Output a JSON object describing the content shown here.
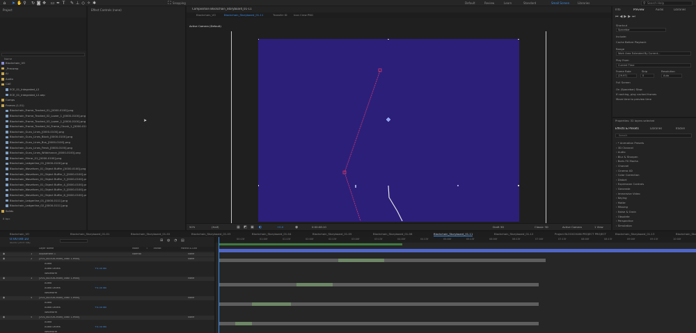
{
  "toolbar": {
    "workspaces": [
      "Default",
      "Review",
      "Learn",
      "Standard",
      "Small Screen",
      "Libraries"
    ],
    "active_workspace": "Default",
    "search_placeholder": "Search Help",
    "tool_icons": [
      "home-icon",
      "selection-tool-icon",
      "hand-tool-icon",
      "zoom-tool-icon",
      "rotate-tool-icon",
      "camera-tool-icon",
      "pan-behind-tool-icon",
      "rectangle-tool-icon",
      "pen-tool-icon",
      "type-tool-icon",
      "brush-tool-icon",
      "clone-stamp-icon",
      "eraser-icon",
      "roto-brush-icon",
      "puppet-pin-icon"
    ],
    "snapping_label": "Snapping"
  },
  "project": {
    "tab_label": "Project",
    "name_header": "Name",
    "items": [
      {
        "label": "Blockchain_VO",
        "kind": "comp"
      },
      {
        "label": "_Precomp",
        "kind": "folder"
      },
      {
        "label": "AI",
        "kind": "folder"
      },
      {
        "label": "Audio",
        "kind": "folder"
      },
      {
        "label": "CAE",
        "kind": "folder"
      },
      {
        "label": "ECE_01_Integrated_L2",
        "kind": "footage"
      },
      {
        "label": "ECE_01_Integrated_L2.aep",
        "kind": "footage"
      },
      {
        "label": "Comps",
        "kind": "folder"
      },
      {
        "label": "Frames (1-51)",
        "kind": "folder"
      },
      {
        "label": "Blockchain_Frame_Tracked_01_[0000-0100].png",
        "kind": "footage"
      },
      {
        "label": "Blockchain_Frame_Tracked_02_Lower_1_[0000-0100].png",
        "kind": "footage"
      },
      {
        "label": "Blockchain_Frame_Tracked_03_Lower_1_[0000-0100].png",
        "kind": "footage"
      },
      {
        "label": "Blockchain_Frame_Tracked_04_Frame_Chunk_1_[0000-0100].png",
        "kind": "footage"
      },
      {
        "label": "Blockchain_Guns_Lines_[0000-0100].png",
        "kind": "footage"
      },
      {
        "label": "Blockchain_Guns_Lines_Block_[0000-0100].png",
        "kind": "footage"
      },
      {
        "label": "Blockchain_Guns_Lines_Bus_[0000-0100].png",
        "kind": "footage"
      },
      {
        "label": "Blockchain_Guns_Lines_Fresh_[0000-0100].png",
        "kind": "footage"
      },
      {
        "label": "Blockchain_Guns_Lines_Wildchance_[0000-0100].png",
        "kind": "footage"
      },
      {
        "label": "Blockchain_Mirror_01_[0000-0100].png",
        "kind": "footage"
      },
      {
        "label": "Blockchain_Ledgerline_01_[0000-0100].png",
        "kind": "footage"
      },
      {
        "label": "Blockchain_Waveform_01_Object Buffer_[0000-0100].png",
        "kind": "footage"
      },
      {
        "label": "Blockchain_Waveform_01_Object Buffer_2_[0000-0100].png",
        "kind": "footage"
      },
      {
        "label": "Blockchain_Waveform_01_Object Buffer_3_[0000-0100].png",
        "kind": "footage"
      },
      {
        "label": "Blockchain_Waveform_01_Object Buffer_4_[0000-0100].png",
        "kind": "footage"
      },
      {
        "label": "Blockchain_Waveform_01_Object Buffer_5_[0000-0100].png",
        "kind": "footage"
      },
      {
        "label": "Blockchain_Waveform_01_Object Buffer_6_[0000-0100].png",
        "kind": "footage"
      },
      {
        "label": "Blockchain_Ledgerline_01_[0000-0111].png",
        "kind": "footage"
      },
      {
        "label": "Blockchain_Ledgerline_02_[0000-0111].png",
        "kind": "footage"
      },
      {
        "label": "Solids",
        "kind": "folder"
      }
    ],
    "bottom_bar": "8 bpc"
  },
  "effect_controls": {
    "tab_label": "Effect Controls (none)"
  },
  "viewer": {
    "tabs": [
      "Blockchain_VO",
      "Blockchain_Storyboard_01-11"
    ],
    "breadcrumb": "Composition Blockchain_Storyboard_01-11",
    "extra_tabs": [
      "Transfer ID",
      "Icon Crew PNG"
    ],
    "camera_label": "Active Camera (Default)",
    "zoom": "50%",
    "resolution": "(Half)",
    "timecode": "0:00:08:10",
    "exposure": "+0.0",
    "renderer": "Draft 3D",
    "view": "Classic 3D",
    "camera_select": "Active Camera",
    "views": "1 View"
  },
  "preview": {
    "tabs": [
      "Info",
      "Preview",
      "Audio",
      "Libraries"
    ],
    "active_tab": "Preview",
    "shortcut_label": "Shortcut",
    "shortcut_value": "Spacebar",
    "include_label": "Include:",
    "cache_label": "Cache Before Playback",
    "range_label": "Range",
    "range_value": "Work Area Extended By Current...",
    "play_from_label": "Play From",
    "play_from_value": "Current Time",
    "frame_rate_label": "Frame Rate",
    "skip_label": "Skip",
    "resolution_label": "Resolution",
    "frame_rate_value": "(29.97)",
    "skip_value": "0",
    "resolution_value": "Auto",
    "full_screen_label": "Full Screen",
    "on_stop_label": "On (Spacebar) Stop:",
    "check1": "If caching, play cached frames",
    "check2": "Move time to preview time"
  },
  "effects_panel": {
    "header": "Properties: 32 layers selected",
    "tabs": [
      "Effects & Presets",
      "Libraries",
      "Tracker"
    ],
    "search_placeholder": "Search",
    "items": [
      "* Animation Presets",
      "3D Channel",
      "Audio",
      "Blur & Sharpen",
      "Boris FX Mocha",
      "Channel",
      "Cinema 4D",
      "Color Correction",
      "Distort",
      "Expression Controls",
      "Generate",
      "Immersive Video",
      "Keying",
      "Matte",
      "Missing",
      "Noise & Grain",
      "Obsolete",
      "Perspective",
      "Simulation"
    ]
  },
  "timeline": {
    "tabs": [
      "Blockchain_VO",
      "Blockchain_Storyboard_01-01",
      "Blockchain_Storyboard_01-02",
      "Blockchain_Storyboard_01-03",
      "Blockchain_Storyboard_01-04",
      "Blockchain_Storyboard_01-05",
      "Blockchain_Storyboard_01-06",
      "Blockchain_Storyboard_01-11",
      "Blockchain_Storyboard_01-12",
      "Project BLOCKCHAIN PROJECT PROJECT",
      "Blockchain_Storyboard_01-13",
      "Blockchain_Storyboard_01-14"
    ],
    "active_tab_index": 7,
    "timecode": "0:00:08:10",
    "fps": "00250 (29.97 fps)",
    "column_headers": [
      "Layer Name",
      "Mode",
      "T",
      "TrkMat",
      "Parent & Link"
    ],
    "ruler": [
      "00:15f",
      "01:00f",
      "01:15f",
      "02:00f",
      "02:15f",
      "03:00f",
      "03:15f",
      "04:00f",
      "04:15f",
      "05:00f",
      "05:15f",
      "06:00f",
      "06:15f",
      "07:00f",
      "07:15f",
      "08:00f",
      "08:15f",
      "09:00f",
      "09:15f",
      "10:00f"
    ],
    "layers": [
      {
        "num": "1",
        "name": "Adjustment 1",
        "mode": "Normal",
        "parent": "None"
      },
      {
        "num": "2",
        "name": "[VOL_BLOCKCHAIN_TAKE 1.mov]",
        "mode": "",
        "parent": "None"
      },
      {
        "num": "",
        "name": "Audio",
        "mode": "",
        "parent": ""
      },
      {
        "num": "",
        "name": "Audio Levels",
        "mode": "",
        "parent": "+0.00 dB"
      },
      {
        "num": "",
        "name": "Waveform",
        "mode": "",
        "parent": ""
      },
      {
        "num": "3",
        "name": "[VOL_BLOCKCHAIN_TAKE 1.mov]",
        "mode": "",
        "parent": "None"
      },
      {
        "num": "",
        "name": "Audio",
        "mode": "",
        "parent": ""
      },
      {
        "num": "",
        "name": "Audio Levels",
        "mode": "",
        "parent": "+0.00 dB"
      },
      {
        "num": "",
        "name": "Waveform",
        "mode": "",
        "parent": ""
      },
      {
        "num": "4",
        "name": "[VOL_BLOCKCHAIN_TAKE 1.mov]",
        "mode": "",
        "parent": "None"
      },
      {
        "num": "",
        "name": "Audio",
        "mode": "",
        "parent": ""
      },
      {
        "num": "",
        "name": "Audio Levels",
        "mode": "",
        "parent": "+0.00 dB"
      },
      {
        "num": "",
        "name": "Waveform",
        "mode": "",
        "parent": ""
      },
      {
        "num": "5",
        "name": "[VOL_BLOCKCHAIN_TAKE 1.mov]",
        "mode": "",
        "parent": "None"
      },
      {
        "num": "",
        "name": "Audio",
        "mode": "",
        "parent": ""
      },
      {
        "num": "",
        "name": "Audio Levels",
        "mode": "",
        "parent": "+0.00 dB"
      },
      {
        "num": "",
        "name": "Waveform",
        "mode": "",
        "parent": ""
      }
    ]
  },
  "colors": {
    "accent": "#3b8eea",
    "comp_bg": "#2c1f7a",
    "adjustment_bar": "#4f66c8",
    "audio_bar": "#6e8766",
    "track_grey": "#5e5e5e"
  }
}
